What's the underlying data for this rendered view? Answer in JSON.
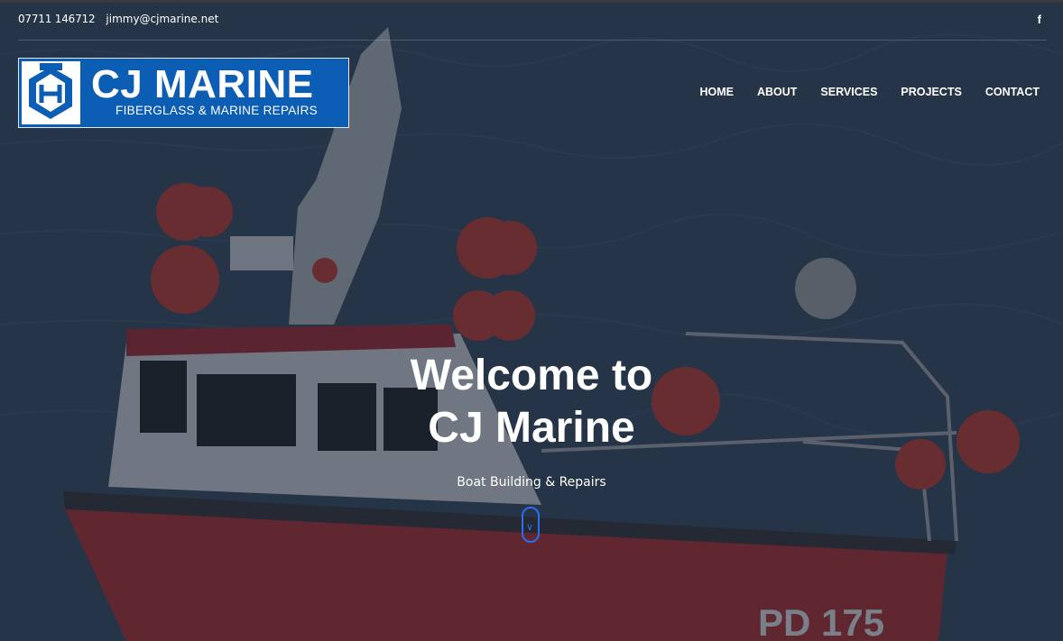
{
  "topbar": {
    "phone": "07711 146712",
    "email": "jimmy@cjmarine.net",
    "social": {
      "icon": "facebook-icon",
      "glyph": "f"
    }
  },
  "logo": {
    "name": "CJ MARINE",
    "tagline": "FIBERGLASS & MARINE REPAIRS"
  },
  "nav": {
    "items": [
      {
        "label": "HOME"
      },
      {
        "label": "ABOUT"
      },
      {
        "label": "SERVICES"
      },
      {
        "label": "PROJECTS"
      },
      {
        "label": "CONTACT"
      }
    ]
  },
  "hero": {
    "title_line1": "Welcome to",
    "title_line2": "CJ Marine",
    "subtitle": "Boat Building & Repairs",
    "scroll_icon": "chevron-down-icon"
  },
  "colors": {
    "brand_blue": "#0c5db4",
    "scroll_accent": "#2e6df0",
    "overlay": "#1b2433"
  }
}
